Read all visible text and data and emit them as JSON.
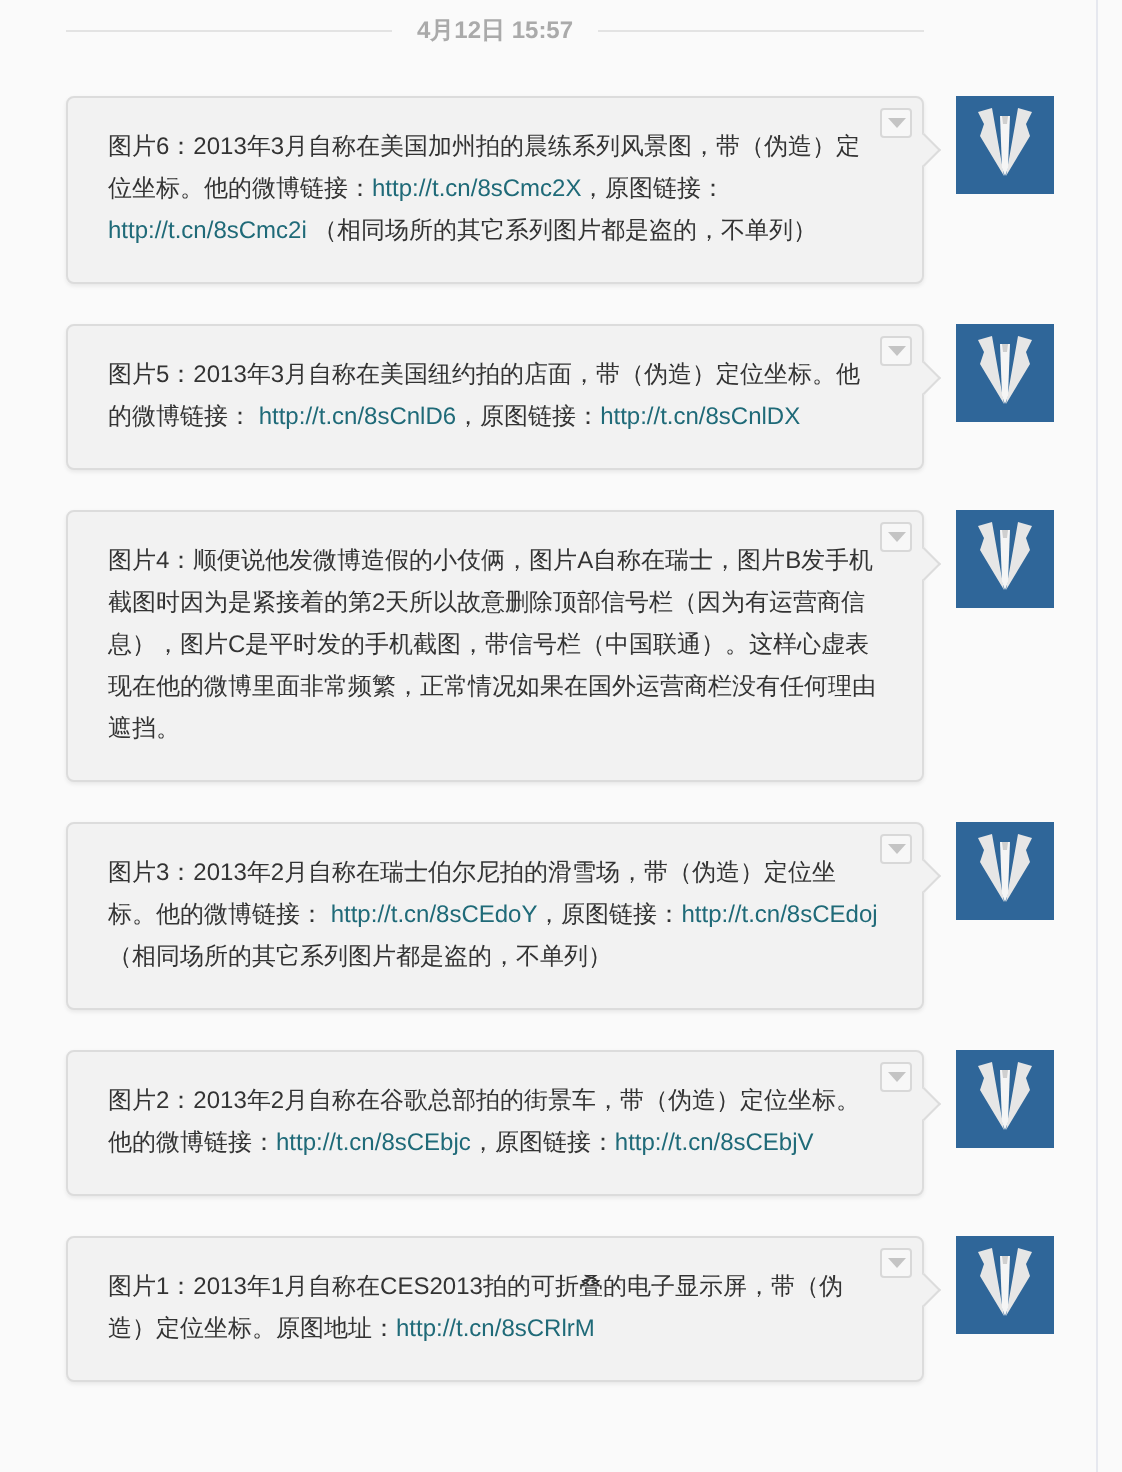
{
  "timestamp": "4月12日 15:57",
  "messages": [
    {
      "segments": [
        {
          "kind": "text",
          "text": "图片6：2013年3月自称在美国加州拍的晨练系列风景图，带（伪造）定位坐标。他的微博链接："
        },
        {
          "kind": "link",
          "text": "http://t.cn/8sCmc2X"
        },
        {
          "kind": "text",
          "text": "，原图链接："
        },
        {
          "kind": "link",
          "text": "http://t.cn/8sCmc2i"
        },
        {
          "kind": "text",
          "text": " （相同场所的其它系列图片都是盗的，不单列）"
        }
      ]
    },
    {
      "segments": [
        {
          "kind": "text",
          "text": "图片5：2013年3月自称在美国纽约拍的店面，带（伪造）定位坐标。他的微博链接： "
        },
        {
          "kind": "link",
          "text": "http://t.cn/8sCnlD6"
        },
        {
          "kind": "text",
          "text": "，原图链接："
        },
        {
          "kind": "link",
          "text": "http://t.cn/8sCnlDX"
        }
      ]
    },
    {
      "segments": [
        {
          "kind": "text",
          "text": "图片4：顺便说他发微博造假的小伎俩，图片A自称在瑞士，图片B发手机截图时因为是紧接着的第2天所以故意删除顶部信号栏（因为有运营商信息），图片C是平时发的手机截图，带信号栏（中国联通）。这样心虚表现在他的微博里面非常频繁，正常情况如果在国外运营商栏没有任何理由遮挡。"
        }
      ]
    },
    {
      "segments": [
        {
          "kind": "text",
          "text": "图片3：2013年2月自称在瑞士伯尔尼拍的滑雪场，带（伪造）定位坐标。他的微博链接： "
        },
        {
          "kind": "link",
          "text": "http://t.cn/8sCEdoY"
        },
        {
          "kind": "text",
          "text": "，原图链接："
        },
        {
          "kind": "link",
          "text": "http://t.cn/8sCEdoj"
        },
        {
          "kind": "text",
          "text": " （相同场所的其它系列图片都是盗的，不单列）"
        }
      ]
    },
    {
      "segments": [
        {
          "kind": "text",
          "text": "图片2：2013年2月自称在谷歌总部拍的街景车，带（伪造）定位坐标。他的微博链接："
        },
        {
          "kind": "link",
          "text": "http://t.cn/8sCEbjc"
        },
        {
          "kind": "text",
          "text": "，原图链接："
        },
        {
          "kind": "link",
          "text": "http://t.cn/8sCEbjV"
        }
      ]
    },
    {
      "segments": [
        {
          "kind": "text",
          "text": "图片1：2013年1月自称在CES2013拍的可折叠的电子显示屏，带（伪造）定位坐标。原图地址："
        },
        {
          "kind": "link",
          "text": "http://t.cn/8sCRlrM"
        }
      ]
    }
  ]
}
